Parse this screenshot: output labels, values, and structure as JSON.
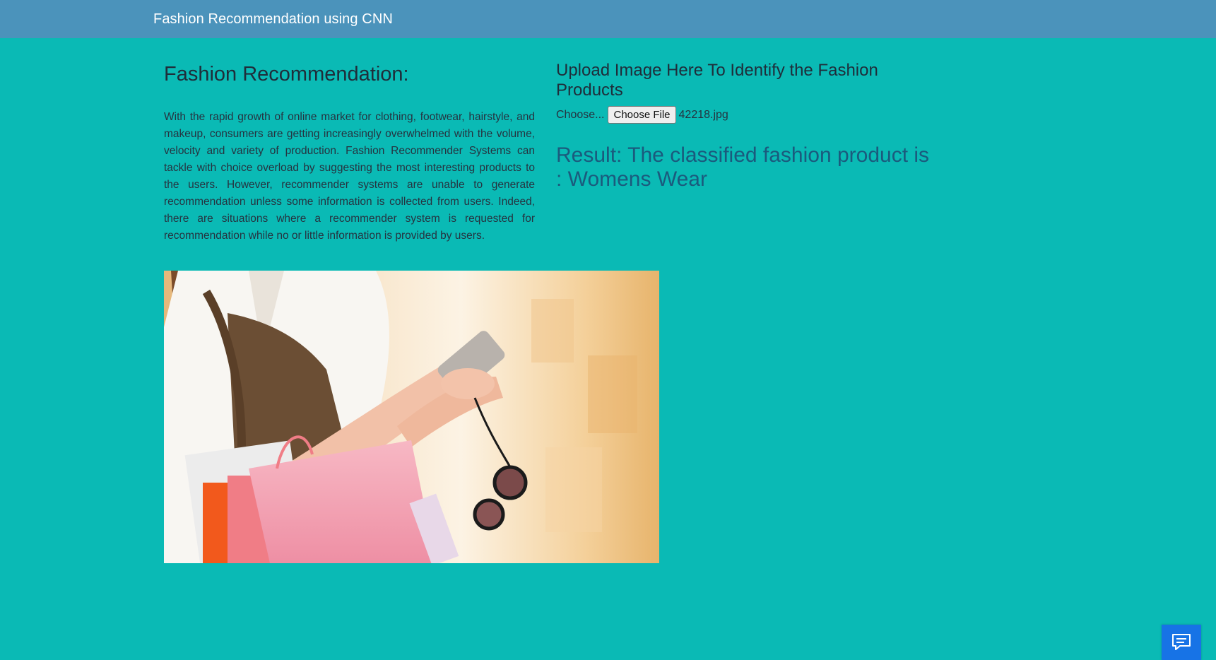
{
  "navbar": {
    "brand": "Fashion Recommendation using CNN"
  },
  "intro": {
    "heading": "Fashion Recommendation:",
    "description": "With the rapid growth of online market for clothing, footwear, hairstyle, and makeup, consumers are getting increasingly overwhelmed with the volume, velocity and variety of production. Fashion Recommender Systems can tackle with choice overload by suggesting the most interesting products to the users. However, recommender systems are unable to generate recommendation unless some information is collected from users. Indeed, there are situations where a recommender system is requested for recommendation while no or little information is provided by users."
  },
  "upload": {
    "title": "Upload Image Here To Identify the Fashion Products",
    "choose_label": "Choose...",
    "button_label": "Choose File",
    "file_name": "42218.jpg"
  },
  "result": {
    "text": "Result: The classified fashion product is : Womens Wear"
  },
  "icons": {
    "chat": "chat-icon"
  },
  "colors": {
    "background": "#0abab5",
    "navbar": "#4b93bb",
    "result_text": "#1b5a7d",
    "chat_button": "#1773e6"
  }
}
